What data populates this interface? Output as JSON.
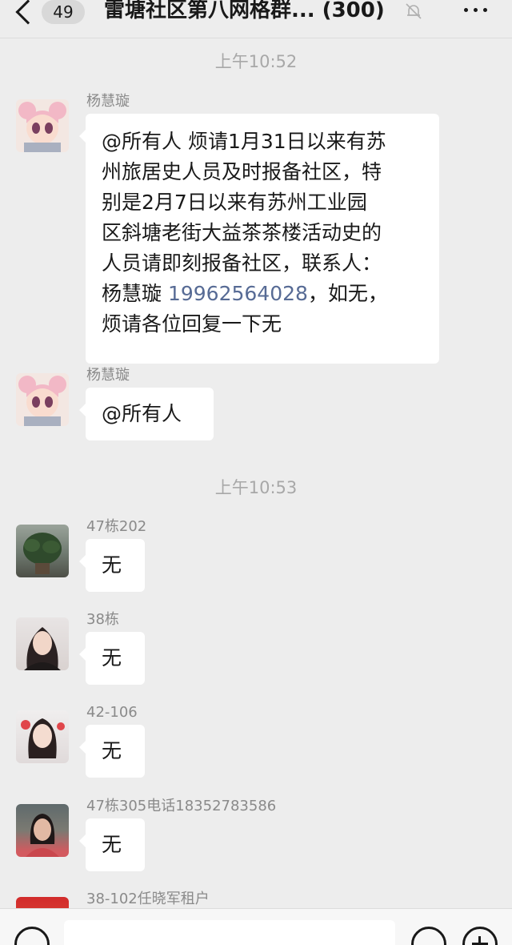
{
  "header": {
    "unread_count": "49",
    "title": "雷塘社区第八网格群... (300)",
    "icons": [
      "back-arrow-icon",
      "mute-bell-icon",
      "more-icon"
    ]
  },
  "timestamps": [
    "上午10:52",
    "上午10:53"
  ],
  "messages": [
    {
      "sender": "杨慧璇",
      "avatar": "anime-girl-avatar",
      "lines": [
        "@所有人  烦请1月31日以来有苏",
        "州旅居史人员及时报备社区，特",
        "别是2月7日以来有苏州工业园",
        "区斜塘老街大益茶茶楼活动史的",
        "人员请即刻报备社区，联系人："
      ],
      "last_line_before_phone": "杨慧璇 ",
      "phone": "19962564028",
      "last_line_after_phone": "，如无，",
      "final_line": "烦请各位回复一下无"
    },
    {
      "sender": "杨慧璇",
      "avatar": "anime-girl-avatar",
      "text": "@所有人"
    },
    {
      "sender": "47栋202",
      "avatar": "plant-avatar",
      "text": "无"
    },
    {
      "sender": "38栋",
      "avatar": "woman-avatar",
      "text": "无"
    },
    {
      "sender": "42-106",
      "avatar": "woman-avatar",
      "text": "无"
    },
    {
      "sender": "47栋305电话18352783586",
      "avatar": "woman-avatar",
      "text": "无"
    },
    {
      "sender": "38-102任晓军租户",
      "avatar": "red-avatar"
    }
  ],
  "input_bar": {
    "icons": [
      "voice-icon",
      "emoji-icon",
      "plus-icon"
    ],
    "text_value": ""
  },
  "colors": {
    "background": "#ededed",
    "bubble": "#ffffff",
    "link": "#576b95",
    "timestamp": "#a8a8a8",
    "sender": "#8a8a8a"
  }
}
